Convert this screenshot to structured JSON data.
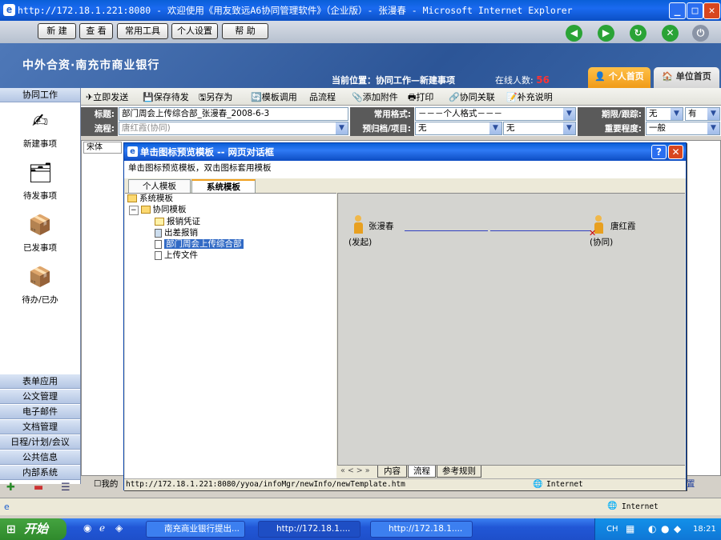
{
  "window": {
    "title": "http://172.18.1.221:8080 - 欢迎使用《用友致远A6协同管理软件》（企业版）- 张漫春 - Microsoft Internet Explorer"
  },
  "topmenu": [
    "新 建",
    "查 看",
    "常用工具",
    "个人设置",
    "帮 助"
  ],
  "banner": {
    "bank": "中外合资·南充市商业银行",
    "location": "当前位置：协同工作—新建事项",
    "online_label": "在线人数:",
    "online_count": "56",
    "tab_personal": "个人首页",
    "tab_unit": "单位首页"
  },
  "sidebar": {
    "header": "协同工作",
    "items": [
      "新建事项",
      "待发事项",
      "已发事项",
      "待办/已办"
    ],
    "bottom": [
      "表单应用",
      "公文管理",
      "电子邮件",
      "文档管理",
      "日程/计划/会议",
      "公共信息",
      "内部系统"
    ]
  },
  "toolbar": [
    "立即发送",
    "保存待发",
    "另存为",
    "模板调用",
    "流程",
    "添加附件",
    "打印",
    "协同关联",
    "补充说明"
  ],
  "form": {
    "title_label": "标题:",
    "title_value": "部门周会上传综合部_张漫春_2008-6-3",
    "flow_label": "流程:",
    "flow_value": "唐红霞(协同)",
    "format_label": "常用格式:",
    "format_value": "－－－个人格式－－－",
    "archive_label": "预归档/项目:",
    "archive_value1": "无",
    "archive_value2": "无",
    "deadline_label": "期限/跟踪:",
    "deadline_value": "无",
    "track_value": "有",
    "importance_label": "重要程度:",
    "importance_value": "一般",
    "font": "宋体"
  },
  "dialog": {
    "title": "单击图标预览模板 -- 网页对话框",
    "hint": "单击图标预览模板，双击图标套用模板",
    "tabs": [
      "个人模板",
      "系统模板"
    ],
    "tree": {
      "root": "系统模板",
      "group": "协同模板",
      "items": [
        "报销凭证",
        "出差报销",
        "部门周会上传综合部",
        "上传文件"
      ]
    },
    "flow": {
      "start_name": "张漫春",
      "start_role": "(发起)",
      "end_name": "唐红霞",
      "end_role": "(协同)"
    },
    "bottom_tabs": [
      "内容",
      "流程",
      "参考规则"
    ],
    "nav": "«  <  >  »",
    "status_url": "http://172.18.1.221:8080/yyoa/infoMgr/newInfo/newTemplate.htm",
    "status_zone": "Internet"
  },
  "behind_status": {
    "left": "我的",
    "right": "置"
  },
  "statusbar": {
    "zone": "Internet"
  },
  "taskbar": {
    "start": "开始",
    "tasks": [
      "南充商业银行提出...",
      "http://172.18.1....",
      "http://172.18.1...."
    ],
    "lang": "CH",
    "time": "18:21"
  }
}
